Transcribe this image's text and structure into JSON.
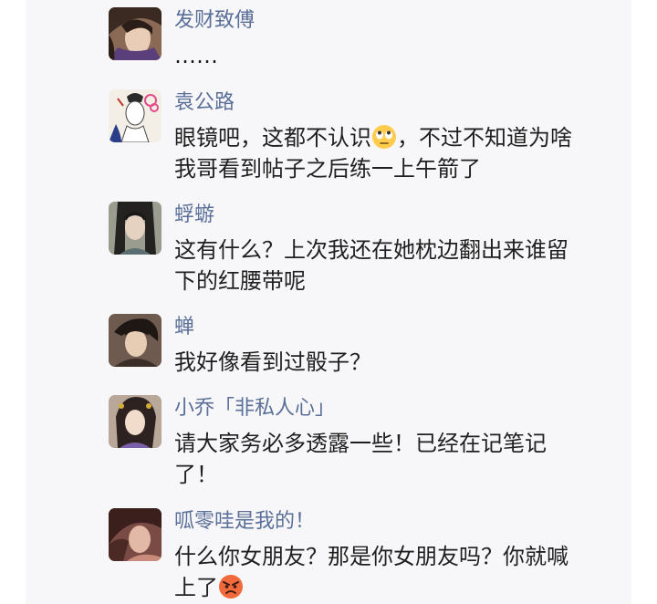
{
  "messages": [
    {
      "name": "发财致傅",
      "text": "……",
      "avatar_icon": "avatar-man-dark-hair-icon"
    },
    {
      "name": "袁公路",
      "text_before": "眼镜吧，这都不认识",
      "emoji": "eye-roll-emoji-icon",
      "text_after": "，不过不知道为啥\n我哥看到帖子之后练一上午箭了",
      "avatar_icon": "avatar-sketch-man-icon"
    },
    {
      "name": "蜉蝣",
      "text": "这有什么？上次我还在她枕边翻出来谁留\n下的红腰带呢",
      "avatar_icon": "avatar-man-long-hair-icon"
    },
    {
      "name": "蝉",
      "text": "我好像看到过骰子？",
      "avatar_icon": "avatar-man-short-hair-icon"
    },
    {
      "name": "小乔「非私人心」",
      "text": "请大家务必多透露一些！已经在记笔记\n了！",
      "avatar_icon": "avatar-woman-ornate-icon"
    },
    {
      "name": "呱零哇是我的！",
      "text_before": "什么你女朋友？那是你女朋友吗？你就喊\n上了",
      "emoji": "angry-face-emoji-icon",
      "avatar_icon": "avatar-man-red-tint-icon"
    }
  ],
  "colors": {
    "name": "#5a6f98",
    "text": "#1f1f1f",
    "panel": "#f7f7f9"
  }
}
